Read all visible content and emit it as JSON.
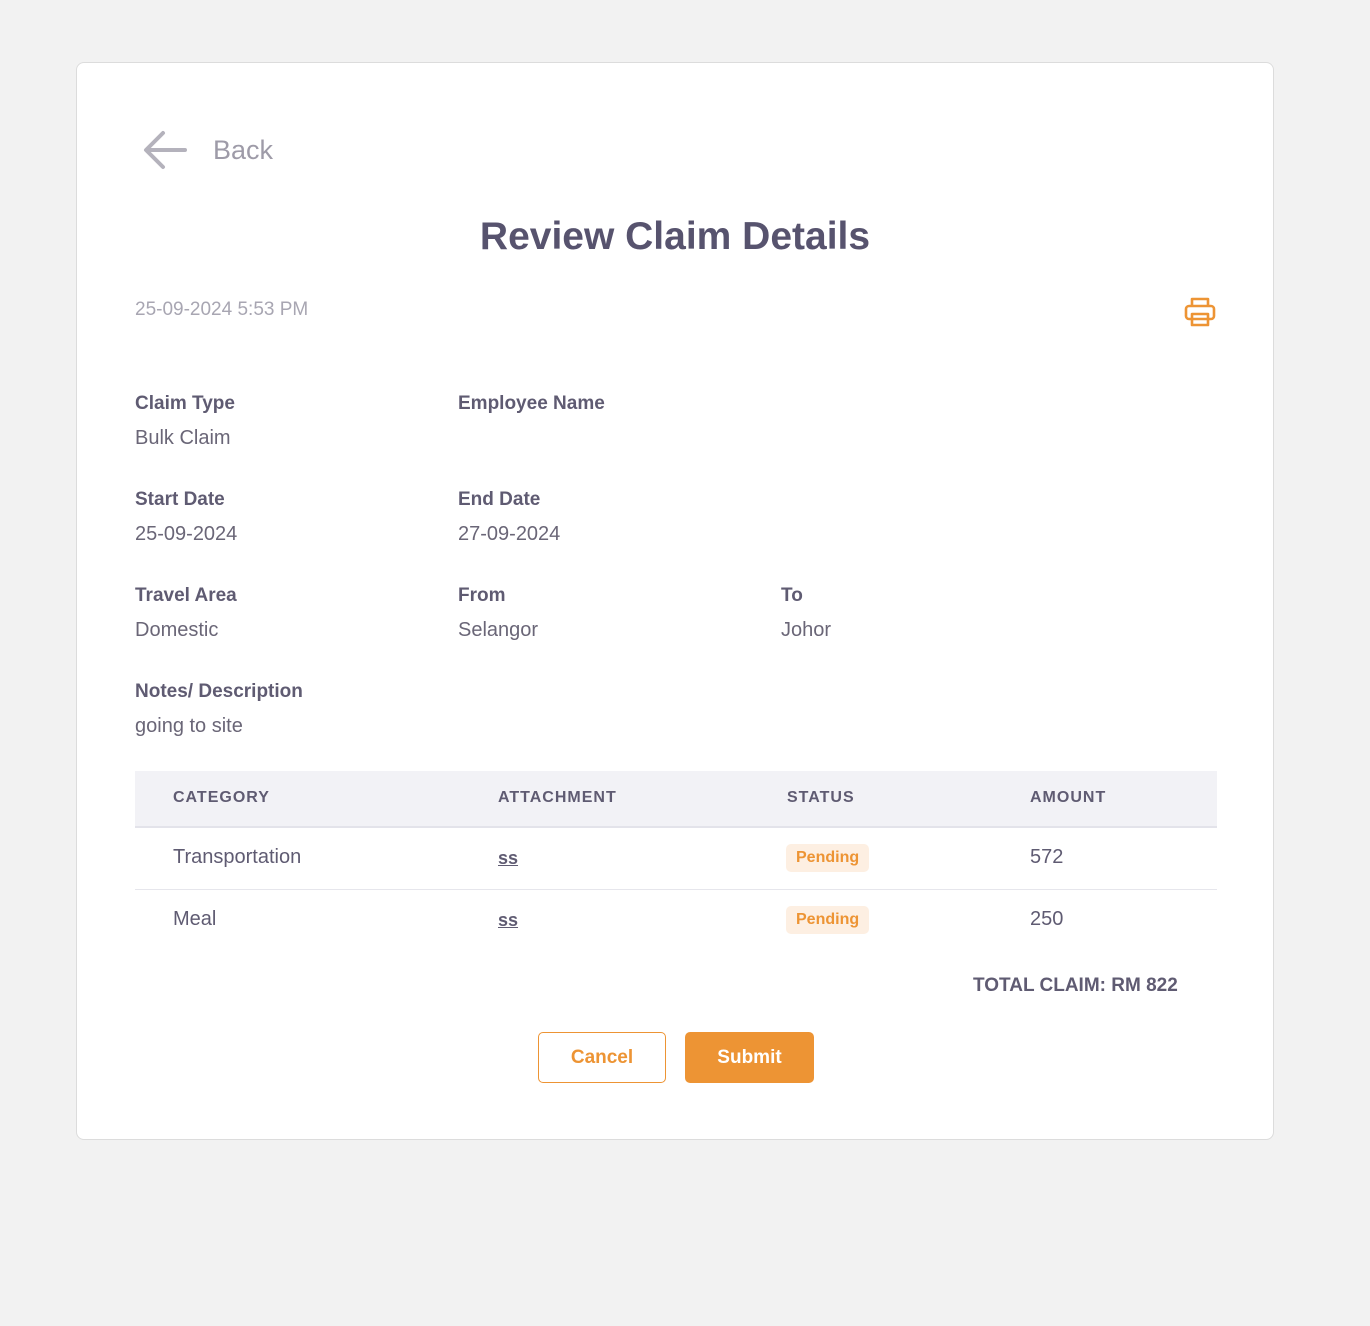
{
  "back": {
    "label": "Back"
  },
  "title": "Review Claim Details",
  "timestamp": "25-09-2024 5:53 PM",
  "colors": {
    "accent": "#ED9434",
    "badge_bg": "#FDEFE2",
    "text": "#57536E"
  },
  "icons": {
    "back": "arrow-left-icon",
    "print": "printer-icon"
  },
  "fields": {
    "claim_type": {
      "label": "Claim Type",
      "value": "Bulk Claim"
    },
    "employee_name": {
      "label": "Employee Name",
      "value": ""
    },
    "start_date": {
      "label": "Start Date",
      "value": "25-09-2024"
    },
    "end_date": {
      "label": "End Date",
      "value": "27-09-2024"
    },
    "travel_area": {
      "label": "Travel Area",
      "value": "Domestic"
    },
    "from": {
      "label": "From",
      "value": "Selangor"
    },
    "to": {
      "label": "To",
      "value": "Johor"
    },
    "notes": {
      "label": "Notes/ Description",
      "value": "going to site"
    }
  },
  "table": {
    "headers": [
      "CATEGORY",
      "ATTACHMENT",
      "STATUS",
      "AMOUNT"
    ],
    "rows": [
      {
        "category": "Transportation",
        "attachment": "ss",
        "status": "Pending",
        "amount": "572"
      },
      {
        "category": "Meal",
        "attachment": "ss",
        "status": "Pending",
        "amount": "250"
      }
    ]
  },
  "total": "TOTAL CLAIM: RM 822",
  "buttons": {
    "cancel": "Cancel",
    "submit": "Submit"
  }
}
